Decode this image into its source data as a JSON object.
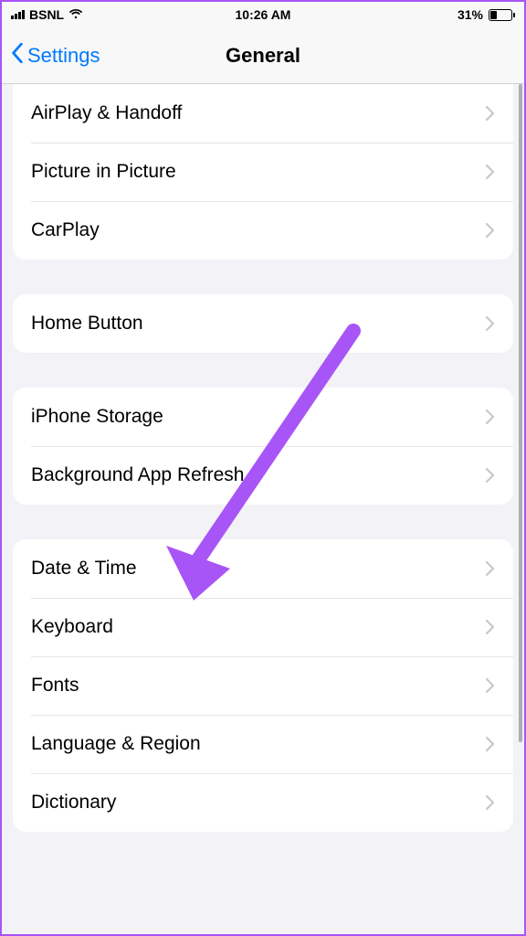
{
  "status": {
    "carrier": "BSNL",
    "time": "10:26 AM",
    "battery_percent": "31%"
  },
  "nav": {
    "back_label": "Settings",
    "title": "General"
  },
  "groups": [
    {
      "rows": [
        {
          "label": "AirPlay & Handoff"
        },
        {
          "label": "Picture in Picture"
        },
        {
          "label": "CarPlay"
        }
      ]
    },
    {
      "rows": [
        {
          "label": "Home Button"
        }
      ]
    },
    {
      "rows": [
        {
          "label": "iPhone Storage"
        },
        {
          "label": "Background App Refresh"
        }
      ]
    },
    {
      "rows": [
        {
          "label": "Date & Time"
        },
        {
          "label": "Keyboard"
        },
        {
          "label": "Fonts"
        },
        {
          "label": "Language & Region"
        },
        {
          "label": "Dictionary"
        }
      ]
    }
  ],
  "annotation": {
    "color": "#a855f7"
  }
}
